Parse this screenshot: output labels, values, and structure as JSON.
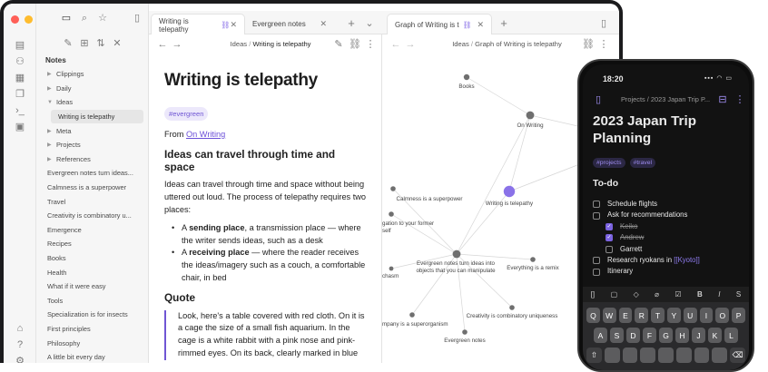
{
  "left_tabs": [
    {
      "label": "Writing is telepathy"
    },
    {
      "label": "Evergreen notes"
    }
  ],
  "right_tab": {
    "label": "Graph of Writing is t"
  },
  "sidebar": {
    "title": "Notes",
    "items": [
      {
        "label": "Clippings",
        "folder": true
      },
      {
        "label": "Daily",
        "folder": true
      },
      {
        "label": "Ideas",
        "folder": true,
        "open": true
      },
      {
        "label": "Writing is telepathy",
        "child": true,
        "active": true
      },
      {
        "label": "Meta",
        "folder": true
      },
      {
        "label": "Projects",
        "folder": true
      },
      {
        "label": "References",
        "folder": true
      },
      {
        "label": "Evergreen notes turn ideas..."
      },
      {
        "label": "Calmness is a superpower"
      },
      {
        "label": "Travel"
      },
      {
        "label": "Creativity is combinatory u..."
      },
      {
        "label": "Emergence"
      },
      {
        "label": "Recipes"
      },
      {
        "label": "Books"
      },
      {
        "label": "Health"
      },
      {
        "label": "What if it were easy"
      },
      {
        "label": "Tools"
      },
      {
        "label": "Specialization is for insects"
      },
      {
        "label": "First principles"
      },
      {
        "label": "Philosophy"
      },
      {
        "label": "A little bit every day"
      }
    ]
  },
  "editor": {
    "crumb_folder": "Ideas",
    "crumb_sep": "/",
    "crumb_note": "Writing is telepathy",
    "title": "Writing is telepathy",
    "tag": "#evergreen",
    "from_label": "From ",
    "from_link": "On Writing",
    "h2_travel": "Ideas can travel through time and space",
    "para": "Ideas can travel through time and space without being uttered out loud. The process of telepathy requires two places:",
    "bullet1_bold": "sending place",
    "bullet1_pre": "A ",
    "bullet1_rest": ", a transmission place — where the writer sends ideas, such as a desk",
    "bullet2_bold": "receiving place",
    "bullet2_pre": "A ",
    "bullet2_rest": " — where the reader receives the ideas/imagery such as a couch, a comfortable chair, in bed",
    "h2_quote": "Quote",
    "quote": "Look, here's a table covered with red cloth. On it is a cage the size of a small fish aquarium. In the cage is a white rabbit with a pink nose and pink-rimmed eyes. On its back, clearly marked in blue"
  },
  "graph": {
    "crumb_folder": "Ideas",
    "crumb_sep": "/",
    "crumb_note": "Graph of Writing is telepathy",
    "nodes": [
      {
        "label": "Books"
      },
      {
        "label": "On Writing"
      },
      {
        "label": "Calmness is a superpower"
      },
      {
        "label": "Writing is telepathy"
      },
      {
        "label": "gation to your former"
      },
      {
        "label": "self"
      },
      {
        "label": "Evergreen notes turn ideas into"
      },
      {
        "label": "objects that you can manipulate"
      },
      {
        "label": "Everything is a remix"
      },
      {
        "label": "chasm"
      },
      {
        "label": "mpany is a superorganism"
      },
      {
        "label": "Creativity is combinatory uniqueness"
      },
      {
        "label": "Evergreen notes"
      }
    ]
  },
  "phone": {
    "time": "18:20",
    "status": "▪▪▪ ◠ ▭",
    "crumb_folder": "Projects",
    "crumb_sep": "/",
    "crumb_note": "2023 Japan Trip P...",
    "title": "2023 Japan Trip Planning",
    "tags": [
      "#projects",
      "#travel"
    ],
    "h2": "To-do",
    "todos": [
      {
        "label": "Schedule flights",
        "done": false,
        "indent": false
      },
      {
        "label": "Ask for recommendations",
        "done": false,
        "indent": false
      },
      {
        "label": "Keiko",
        "done": true,
        "indent": true
      },
      {
        "label": "Andrew",
        "done": true,
        "indent": true
      },
      {
        "label": "Garrett",
        "done": false,
        "indent": true
      },
      {
        "label": "Research ryokans in ",
        "link": "[[Kyoto]]",
        "done": false,
        "indent": false
      },
      {
        "label": "Itinerary",
        "done": false,
        "indent": false
      }
    ],
    "keys_row1": [
      "Q",
      "W",
      "E",
      "R",
      "T",
      "Y",
      "U",
      "I",
      "O",
      "P"
    ],
    "keys_row2": [
      "A",
      "S",
      "D",
      "F",
      "G",
      "H",
      "J",
      "K",
      "L"
    ]
  },
  "colors": {
    "accent": "#7056d4",
    "active_node": "#8a72e8"
  }
}
